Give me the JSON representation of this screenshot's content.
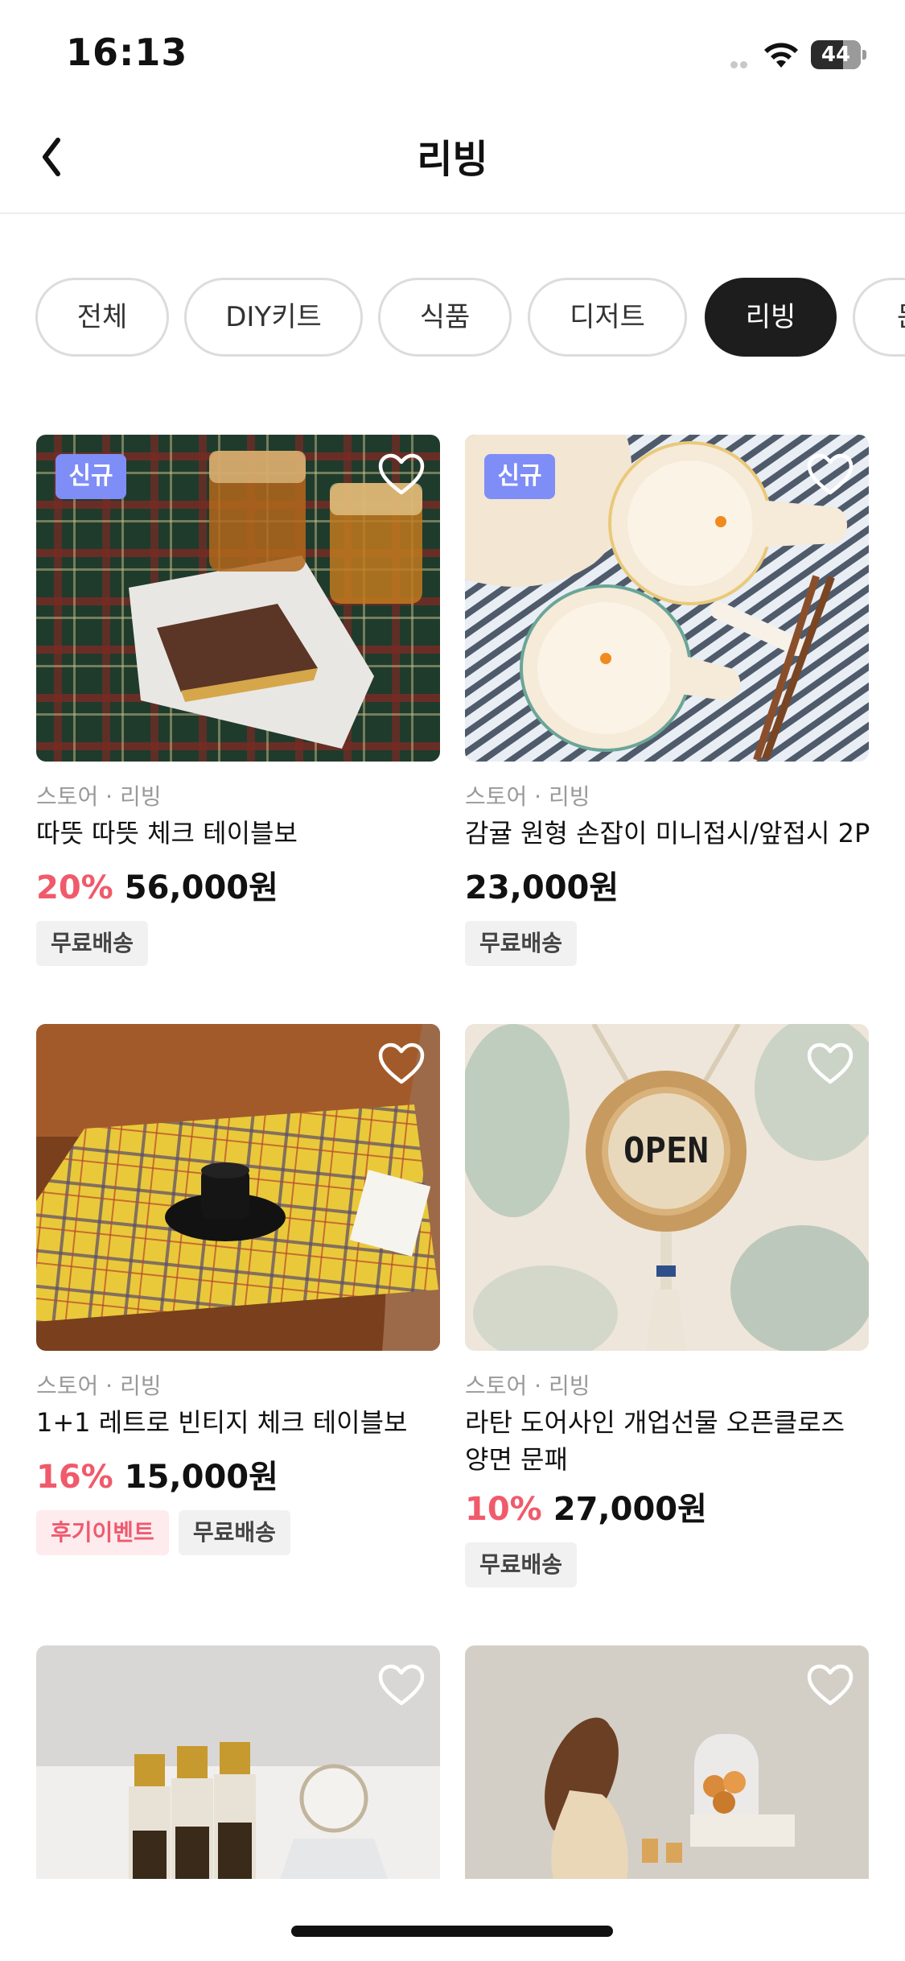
{
  "status": {
    "time": "16:13",
    "battery": "44"
  },
  "header": {
    "title": "리빙"
  },
  "chips": [
    {
      "label": "전체",
      "active": false
    },
    {
      "label": "DIY키트",
      "active": false
    },
    {
      "label": "식품",
      "active": false
    },
    {
      "label": "디저트",
      "active": false
    },
    {
      "label": "리빙",
      "active": true
    },
    {
      "label": "문",
      "active": false
    }
  ],
  "products": [
    {
      "store": "스토어 · 리빙",
      "name": "따뜻 따뜻 체크 테이블보",
      "discount": "20%",
      "price": "56,000원",
      "badge": "신규",
      "tags": [
        "무료배송"
      ]
    },
    {
      "store": "스토어 · 리빙",
      "name": "감귤 원형 손잡이 미니접시/앞접시 2P",
      "discount": "",
      "price": "23,000원",
      "badge": "신규",
      "tags": [
        "무료배송"
      ]
    },
    {
      "store": "스토어 · 리빙",
      "name": "1+1 레트로 빈티지 체크 테이블보",
      "discount": "16%",
      "price": "15,000원",
      "badge": "",
      "tags": [
        "후기이벤트",
        "무료배송"
      ]
    },
    {
      "store": "스토어 · 리빙",
      "name": "라탄 도어사인 개업선물 오픈클로즈 양면 문패",
      "discount": "10%",
      "price": "27,000원",
      "badge": "",
      "tags": [
        "무료배송"
      ],
      "image_text": "OPEN"
    }
  ]
}
